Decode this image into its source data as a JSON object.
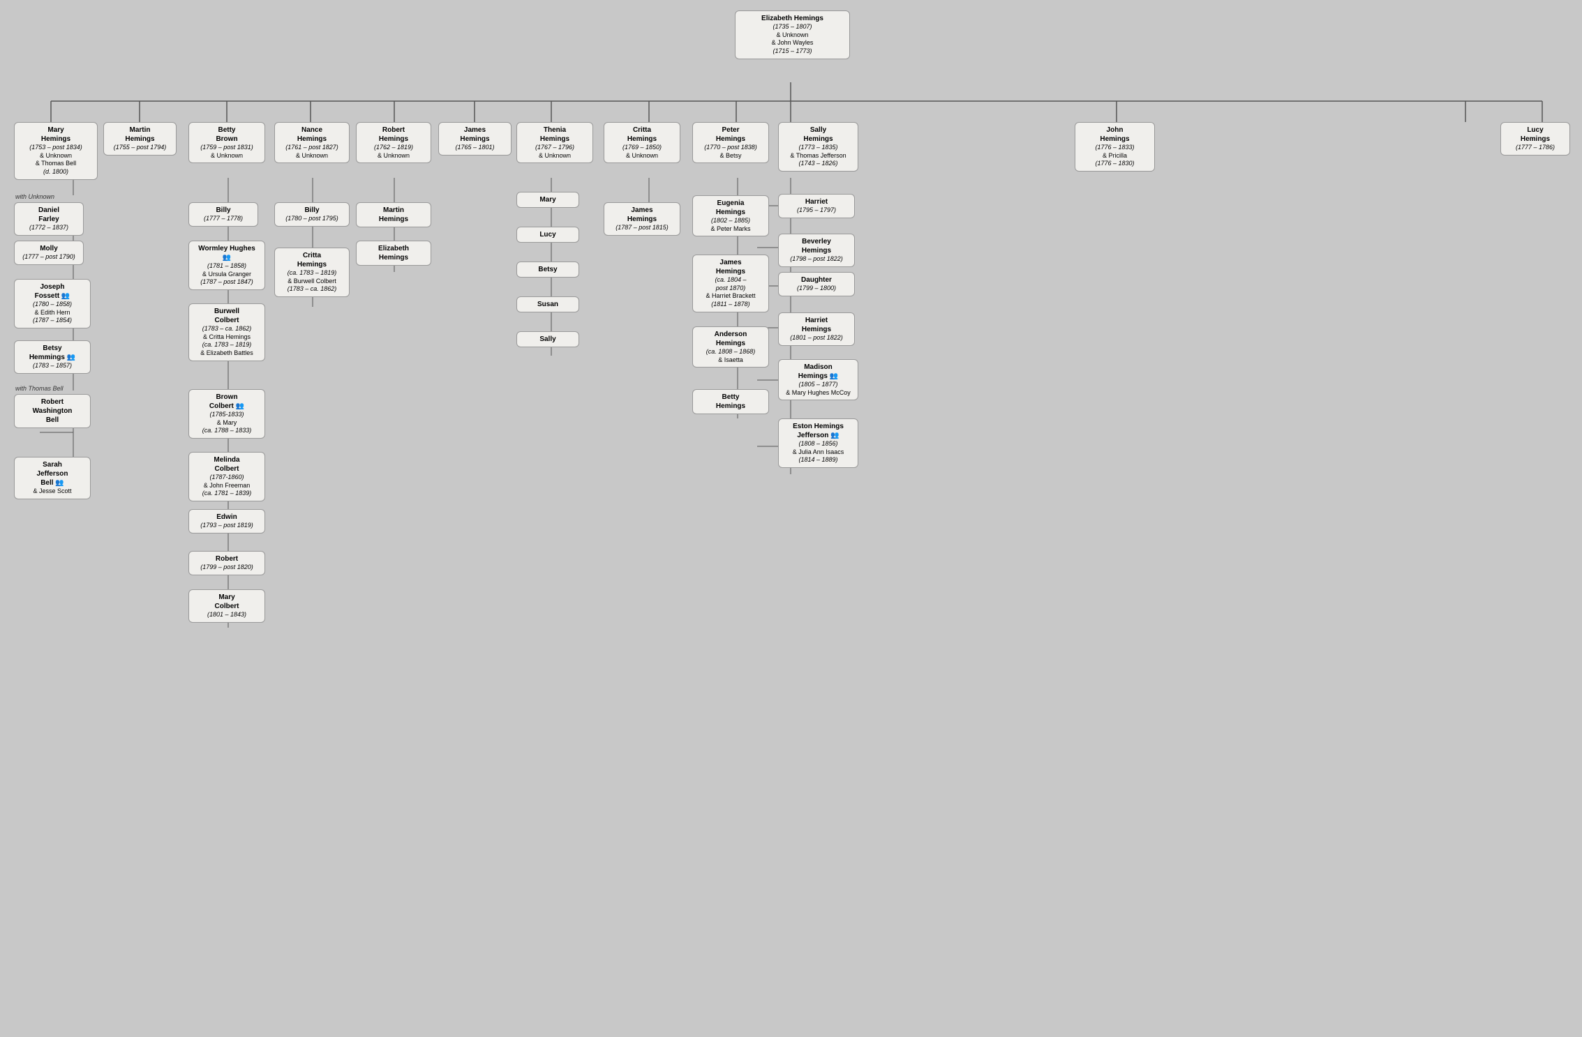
{
  "root": {
    "name": "Elizabeth Hemings",
    "dates": "(1735 – 1807)",
    "partners": [
      "& Unknown",
      "& John Wayles",
      "(1715 – 1773)"
    ]
  },
  "columns": [
    {
      "id": "mary-hemings",
      "name": "Mary Hemings",
      "dates": "(1753 – post 1834)",
      "partners": [
        "& Unknown",
        "& Thomas Bell",
        "(d. 1800)"
      ],
      "section_unknown": "with Unknown",
      "section_bell": "with Thomas Bell",
      "children_unknown": [
        {
          "name": "Daniel Farley",
          "dates": "(1772 – 1837)"
        },
        {
          "name": "Molly",
          "dates": "(1777 – post 1790)"
        },
        {
          "name": "Joseph Fossett",
          "dates": "(1780 – 1858)",
          "partner": "& Edith Hern (1787 – 1854)",
          "icon": true
        },
        {
          "name": "Betsy Hemmings",
          "dates": "(1783 – 1857)",
          "icon": true
        }
      ],
      "children_bell": [
        {
          "name": "Robert Washington Bell",
          "dates": ""
        },
        {
          "name": "Sarah Jefferson Bell",
          "dates": "",
          "partner": "& Jesse Scott",
          "icon": true
        }
      ]
    },
    {
      "id": "martin-hemings",
      "name": "Martin Hemings",
      "dates": "(1755 – post 1794)"
    },
    {
      "id": "betty-brown",
      "name": "Betty Brown",
      "dates": "(1759 – post 1831)",
      "partners": [
        "& Unknown"
      ],
      "children": [
        {
          "name": "Billy",
          "dates": "(1777 – 1778)"
        },
        {
          "name": "Wormley Hughes",
          "dates": "(1781 – 1858)",
          "partner": "& Ursula Granger (1787 – post 1847)",
          "icon": true
        },
        {
          "name": "Burwell Colbert",
          "dates": "(1783 – ca. 1862)",
          "partners": [
            "& Critta Hemings (ca. 1783 – 1819)",
            "& Elizabeth Battles"
          ]
        },
        {
          "name": "Brown Colbert",
          "dates": "(1785-1833)",
          "partner": "& Mary (ca. 1788 – 1833)",
          "icon": true
        },
        {
          "name": "Melinda Colbert",
          "dates": "(1787-1860)",
          "partner": "& John Freeman (ca. 1781 – 1839)"
        },
        {
          "name": "Edwin",
          "dates": "(1793 – post 1819)"
        },
        {
          "name": "Robert",
          "dates": "(1799 – post 1820)"
        },
        {
          "name": "Mary Colbert",
          "dates": "(1801 – 1843)"
        }
      ]
    },
    {
      "id": "nance-hemings",
      "name": "Nance Hemings",
      "dates": "(1761 – post 1827)",
      "partners": [
        "& Unknown"
      ],
      "children": [
        {
          "name": "Billy",
          "dates": "(1780 – post 1795)"
        },
        {
          "name": "Critta Hemings",
          "dates": "(ca. 1783 – 1819)",
          "partner": "& Burwell Colbert (1783 – ca. 1862)"
        }
      ]
    },
    {
      "id": "robert-hemings",
      "name": "Robert Hemings",
      "dates": "(1762 – 1819)",
      "partners": [
        "& Unknown"
      ],
      "children": [
        {
          "name": "Martin Hemings",
          "dates": ""
        },
        {
          "name": "Elizabeth Hemings",
          "dates": ""
        }
      ]
    },
    {
      "id": "james-hemings",
      "name": "James Hemings",
      "dates": "(1765 – 1801)"
    },
    {
      "id": "thenia-hemings",
      "name": "Thenia Hemings",
      "dates": "(1767 – 1796)",
      "partners": [
        "& Unknown"
      ],
      "children": [
        {
          "name": "Mary",
          "dates": ""
        },
        {
          "name": "Lucy",
          "dates": ""
        },
        {
          "name": "Betsy",
          "dates": ""
        },
        {
          "name": "Susan",
          "dates": ""
        },
        {
          "name": "Sally",
          "dates": ""
        }
      ]
    },
    {
      "id": "critta-hemings",
      "name": "Critta Hemings",
      "dates": "(1769 – 1850)",
      "partners": [
        "& Unknown"
      ],
      "children": [
        {
          "name": "James Hemings",
          "dates": "(1787 – post 1815)"
        }
      ]
    },
    {
      "id": "peter-hemings",
      "name": "Peter Hemings",
      "dates": "(1770 – post 1838)",
      "partners": [
        "& Betsy"
      ],
      "children": [
        {
          "name": "Eugenia Hemings",
          "dates": "(1802 – 1885)",
          "partner": "& Peter Marks"
        },
        {
          "name": "James Hemings",
          "dates": "(ca. 1804 – post 1870)",
          "partner": "& Harriet Brackett (1811 – 1878)"
        },
        {
          "name": "Anderson Hemings",
          "dates": "(ca. 1808 – 1868)",
          "partner": "& Isaetta"
        },
        {
          "name": "Betty Hemings",
          "dates": ""
        }
      ]
    },
    {
      "id": "sally-hemings",
      "name": "Sally Hemings",
      "dates": "(1773 – 1835)",
      "partners": [
        "& Thomas Jefferson",
        "(1743 – 1826)"
      ],
      "children": [
        {
          "name": "Harriet",
          "dates": "(1795 – 1797)"
        },
        {
          "name": "Beverley Hemings",
          "dates": "(1798 – post 1822)"
        },
        {
          "name": "Daughter",
          "dates": "(1799 – 1800)"
        },
        {
          "name": "Harriet Hemings",
          "dates": "(1801 – post 1822)"
        },
        {
          "name": "Madison Hemings",
          "dates": "(1805 – 1877)",
          "partner": "& Mary Hughes McCoy",
          "icon": true
        },
        {
          "name": "Eston Hemings Jefferson",
          "dates": "(1808 – 1856)",
          "partner": "& Julia Ann Isaacs (1814 – 1889)",
          "icon": true
        }
      ]
    },
    {
      "id": "john-hemings",
      "name": "John Hemings",
      "dates": "(1776 – 1833)",
      "partners": [
        "& Pricilla",
        "(1776 – 1830)"
      ]
    },
    {
      "id": "lucy-hemings",
      "name": "Lucy Hemings",
      "dates": "(1777 – 1786)"
    }
  ]
}
